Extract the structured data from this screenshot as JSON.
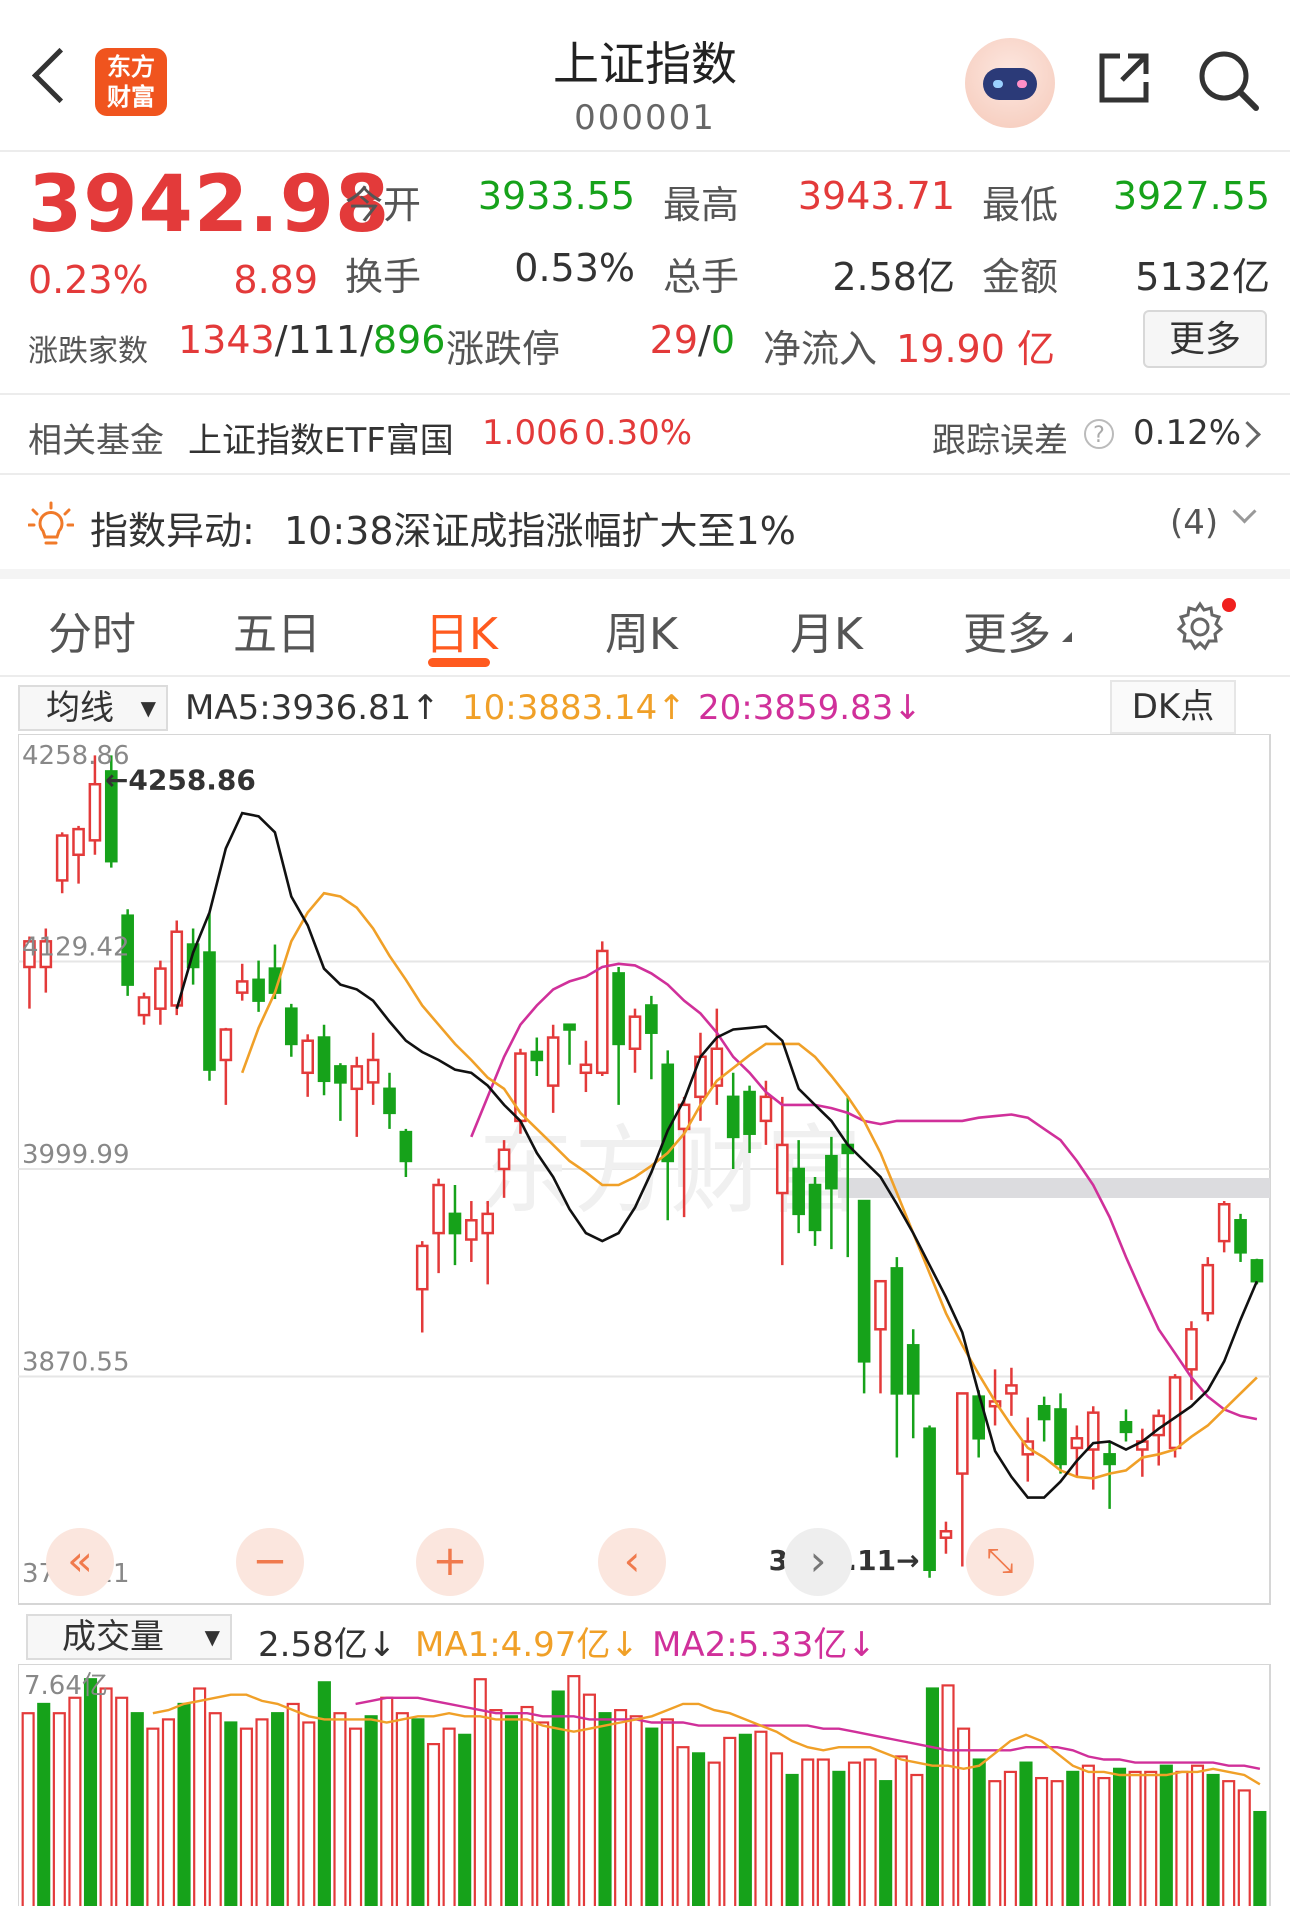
{
  "header": {
    "title": "上证指数",
    "code": "000001",
    "logo_text_1": "东方",
    "logo_text_2": "财富"
  },
  "quote": {
    "price": "3942.98",
    "change_pct": "0.23%",
    "change": "8.89",
    "open_label": "今开",
    "open": "3933.55",
    "high_label": "最高",
    "high": "3943.71",
    "low_label": "最低",
    "low": "3927.55",
    "turnover_rate_label": "换手",
    "turnover_rate": "0.53%",
    "total_hands_label": "总手",
    "total_hands": "2.58亿",
    "amount_label": "金额",
    "amount": "5132亿",
    "breadth_label": "涨跌家数",
    "breadth_up": "1343",
    "breadth_flat": "111",
    "breadth_down": "896",
    "limit_label": "涨跌停",
    "limit_up": "29",
    "limit_down": "0",
    "net_inflow_label": "净流入",
    "net_inflow": "19.90 亿",
    "more_label": "更多"
  },
  "fund": {
    "label": "相关基金",
    "name": "上证指数ETF富国",
    "price": "1.006",
    "change_pct": "0.30%",
    "tracking_label": "跟踪误差",
    "tracking_value": "0.12%"
  },
  "alert": {
    "label": "指数异动:",
    "text": "10:38深证成指涨幅扩大至1%",
    "count": "(4)"
  },
  "tabs": [
    "分时",
    "五日",
    "日K",
    "周K",
    "月K",
    "更多"
  ],
  "active_tab": "日K",
  "ma_legend": {
    "selector": "均线",
    "ma5": "MA5:3936.81↑",
    "ma10": "10:3883.14↑",
    "ma20": "20:3859.83↓",
    "dk_label": "DK点"
  },
  "volume_legend": {
    "selector": "成交量",
    "value": "2.58亿↓",
    "ma1": "MA1:4.97亿↓",
    "ma2": "MA2:5.33亿↓"
  },
  "colors": {
    "up": "#e33a3a",
    "down": "#16a21a",
    "ma5": "#111111",
    "ma10": "#f0a028",
    "ma20": "#d0309a",
    "accent": "#ff5a1f"
  },
  "chart_data": {
    "type": "candlestick",
    "y_axis_labels": [
      "4258.86",
      "4129.42",
      "3999.99",
      "3870.55",
      "3741.11"
    ],
    "ylim": [
      3741.11,
      4258.86
    ],
    "max_annotation": "←4258.86",
    "min_annotation": "3741.11→",
    "candles": [
      [
        4126,
        4142,
        4100,
        4145
      ],
      [
        4126,
        4142,
        4110,
        4150
      ],
      [
        4180,
        4208,
        4172,
        4210
      ],
      [
        4196,
        4212,
        4178,
        4214
      ],
      [
        4205,
        4240,
        4196,
        4258
      ],
      [
        4248,
        4192,
        4188,
        4258
      ],
      [
        4158,
        4115,
        4108,
        4162
      ],
      [
        4096,
        4107,
        4090,
        4110
      ],
      [
        4100,
        4125,
        4090,
        4130
      ],
      [
        4102,
        4148,
        4096,
        4155
      ],
      [
        4140,
        4126,
        4115,
        4150
      ],
      [
        4135,
        4062,
        4055,
        4160
      ],
      [
        4068,
        4087,
        4040,
        4088
      ],
      [
        4110,
        4117,
        4105,
        4128
      ],
      [
        4118,
        4105,
        4098,
        4130
      ],
      [
        4125,
        4110,
        4106,
        4140
      ],
      [
        4100,
        4078,
        4070,
        4103
      ],
      [
        4060,
        4080,
        4045,
        4084
      ],
      [
        4082,
        4055,
        4046,
        4090
      ],
      [
        4064,
        4054,
        4030,
        4066
      ],
      [
        4050,
        4064,
        4020,
        4070
      ],
      [
        4054,
        4068,
        4040,
        4085
      ],
      [
        4050,
        4035,
        4025,
        4060
      ],
      [
        4023,
        4005,
        3995,
        4025
      ],
      [
        3925,
        3952,
        3898,
        3955
      ],
      [
        3960,
        3990,
        3935,
        3994
      ],
      [
        3972,
        3960,
        3940,
        3990
      ],
      [
        3956,
        3968,
        3942,
        3980
      ],
      [
        3960,
        3972,
        3928,
        3980
      ],
      [
        4000,
        4012,
        3982,
        4018
      ],
      [
        4030,
        4072,
        4022,
        4075
      ],
      [
        4073,
        4068,
        4058,
        4082
      ],
      [
        4052,
        4082,
        4035,
        4090
      ],
      [
        4090,
        4087,
        4065,
        4090
      ],
      [
        4060,
        4065,
        4048,
        4080
      ],
      [
        4060,
        4136,
        4058,
        4142
      ],
      [
        4122,
        4078,
        4040,
        4126
      ],
      [
        4075,
        4095,
        4060,
        4100
      ],
      [
        4102,
        4085,
        4056,
        4108
      ],
      [
        4065,
        4005,
        3968,
        4074
      ],
      [
        4025,
        4040,
        3970,
        4045
      ],
      [
        4045,
        4070,
        4030,
        4085
      ],
      [
        4052,
        4075,
        4040,
        4100
      ],
      [
        4045,
        4020,
        4000,
        4060
      ],
      [
        4048,
        4022,
        4010,
        4052
      ],
      [
        4030,
        4045,
        4015,
        4055
      ],
      [
        3985,
        4015,
        3940,
        4045
      ],
      [
        4000,
        3972,
        3960,
        4018
      ],
      [
        3990,
        3962,
        3952,
        3995
      ],
      [
        4008,
        3988,
        3950,
        4020
      ],
      [
        4015,
        4010,
        3945,
        4045
      ],
      [
        3980,
        3880,
        3860,
        3980
      ],
      [
        3900,
        3930,
        3860,
        3930
      ],
      [
        3938,
        3860,
        3820,
        3945
      ],
      [
        3890,
        3860,
        3832,
        3900
      ],
      [
        3838,
        3750,
        3745,
        3840
      ],
      [
        3770,
        3774,
        3760,
        3780
      ],
      [
        3810,
        3860,
        3752,
        3860
      ],
      [
        3858,
        3832,
        3820,
        3862
      ],
      [
        3852,
        3855,
        3840,
        3875
      ],
      [
        3860,
        3865,
        3846,
        3876
      ],
      [
        3822,
        3830,
        3805,
        3845
      ],
      [
        3852,
        3844,
        3830,
        3858
      ],
      [
        3850,
        3816,
        3810,
        3860
      ],
      [
        3826,
        3832,
        3808,
        3840
      ],
      [
        3825,
        3848,
        3800,
        3852
      ],
      [
        3822,
        3816,
        3788,
        3830
      ],
      [
        3842,
        3836,
        3830,
        3850
      ],
      [
        3825,
        3830,
        3808,
        3838
      ],
      [
        3834,
        3846,
        3815,
        3850
      ],
      [
        3826,
        3870,
        3820,
        3872
      ],
      [
        3875,
        3900,
        3856,
        3905
      ],
      [
        3910,
        3940,
        3905,
        3945
      ],
      [
        3955,
        3978,
        3948,
        3980
      ],
      [
        3968,
        3948,
        3942,
        3972
      ],
      [
        3943,
        3930,
        3928,
        3944
      ]
    ],
    "ma5": [
      4100,
      4135,
      4160,
      4200,
      4222,
      4220,
      4210,
      4170,
      4152,
      4125,
      4115,
      4112,
      4105,
      4092,
      4080,
      4073,
      4068,
      4062,
      4060,
      4052,
      4040,
      4030,
      4010,
      3995,
      3975,
      3960,
      3955,
      3960,
      3976,
      3998,
      4024,
      4043,
      4070,
      4082,
      4087,
      4088,
      4089,
      4080,
      4050,
      4040,
      4030,
      4015,
      4005,
      3995,
      3978,
      3960,
      3940,
      3920,
      3898,
      3860,
      3824,
      3808,
      3795,
      3795,
      3805,
      3818,
      3829,
      3830,
      3825,
      3830,
      3838,
      3845,
      3852,
      3862,
      3880,
      3906,
      3930
    ],
    "ma10": [
      4060,
      4088,
      4110,
      4142,
      4160,
      4172,
      4170,
      4163,
      4150,
      4133,
      4118,
      4102,
      4090,
      4078,
      4068,
      4057,
      4050,
      4035,
      4025,
      4015,
      4005,
      3998,
      3990,
      3990,
      3995,
      4002,
      4010,
      4022,
      4040,
      4055,
      4063,
      4071,
      4078,
      4078,
      4078,
      4070,
      4058,
      4045,
      4030,
      4010,
      3985,
      3960,
      3935,
      3910,
      3890,
      3872,
      3855,
      3840,
      3826,
      3820,
      3812,
      3808,
      3807,
      3810,
      3812,
      3820,
      3822,
      3825,
      3833,
      3840,
      3850,
      3860,
      3870
    ],
    "ma20": [
      4020,
      4045,
      4070,
      4090,
      4102,
      4112,
      4117,
      4120,
      4126,
      4128,
      4127,
      4122,
      4115,
      4105,
      4097,
      4085,
      4070,
      4060,
      4048,
      4040,
      4040,
      4040,
      4038,
      4035,
      4030,
      4028,
      4030,
      4030,
      4030,
      4030,
      4030,
      4032,
      4033,
      4034,
      4032,
      4025,
      4018,
      4005,
      3990,
      3970,
      3945,
      3922,
      3900,
      3885,
      3870,
      3858,
      3850,
      3846,
      3844
    ]
  },
  "volume_data": {
    "y_axis_label": "7.64亿",
    "volumes": [
      6.5,
      6.8,
      6.5,
      7.0,
      7.6,
      7.3,
      7.0,
      6.5,
      6.0,
      6.3,
      6.8,
      7.3,
      6.5,
      6.2,
      6.0,
      6.3,
      6.5,
      6.8,
      6.2,
      7.5,
      6.5,
      6.0,
      6.4,
      7.0,
      6.5,
      6.3,
      5.5,
      6.0,
      5.8,
      7.6,
      6.6,
      6.4,
      6.7,
      6.2,
      7.2,
      7.7,
      7.1,
      6.5,
      6.6,
      6.4,
      6.0,
      6.3,
      5.4,
      5.2,
      4.9,
      5.7,
      5.8,
      5.9,
      5.2,
      4.5,
      5.0,
      5.0,
      4.6,
      4.9,
      5.0,
      4.3,
      5.1,
      4.5,
      7.3,
      7.4,
      6.0,
      5.0,
      4.3,
      4.6,
      4.9,
      4.4,
      4.3,
      4.6,
      4.8,
      4.4,
      4.7,
      4.6,
      4.6,
      4.8,
      4.6,
      4.8,
      4.5,
      4.3,
      4.0,
      3.3
    ],
    "ma1": [
      6.5,
      6.6,
      6.8,
      6.9,
      7.0,
      7.1,
      7.1,
      6.9,
      6.8,
      6.6,
      6.4,
      6.3,
      6.3,
      6.3,
      6.3,
      6.2,
      6.3,
      6.4,
      6.4,
      6.5,
      6.4,
      6.4,
      6.3,
      6.3,
      6.3,
      6.1,
      6.0,
      5.9,
      6.0,
      6.1,
      6.2,
      6.3,
      6.4,
      6.6,
      6.8,
      6.8,
      6.6,
      6.5,
      6.3,
      6.1,
      5.9,
      5.6,
      5.4,
      5.3,
      5.4,
      5.4,
      5.4,
      5.2,
      5.0,
      4.9,
      4.8,
      4.8,
      4.7,
      4.8,
      5.2,
      5.6,
      5.8,
      5.6,
      5.2,
      4.8,
      4.6,
      4.6,
      4.5,
      4.5,
      4.5,
      4.5,
      4.6,
      4.6,
      4.7,
      4.6,
      4.5,
      4.2
    ],
    "ma2": [
      6.8,
      6.9,
      7.0,
      7.0,
      7.0,
      6.9,
      6.8,
      6.7,
      6.6,
      6.5,
      6.5,
      6.5,
      6.4,
      6.4,
      6.4,
      6.3,
      6.3,
      6.3,
      6.3,
      6.2,
      6.2,
      6.2,
      6.1,
      6.1,
      6.1,
      6.1,
      6.1,
      6.1,
      6.1,
      6.1,
      6.0,
      6.0,
      5.9,
      5.8,
      5.7,
      5.6,
      5.5,
      5.4,
      5.3,
      5.3,
      5.3,
      5.3,
      5.3,
      5.4,
      5.4,
      5.4,
      5.3,
      5.1,
      5.0,
      5.0,
      4.9,
      4.9,
      4.9,
      4.9,
      4.9,
      4.9,
      4.8,
      4.8,
      4.7
    ]
  }
}
